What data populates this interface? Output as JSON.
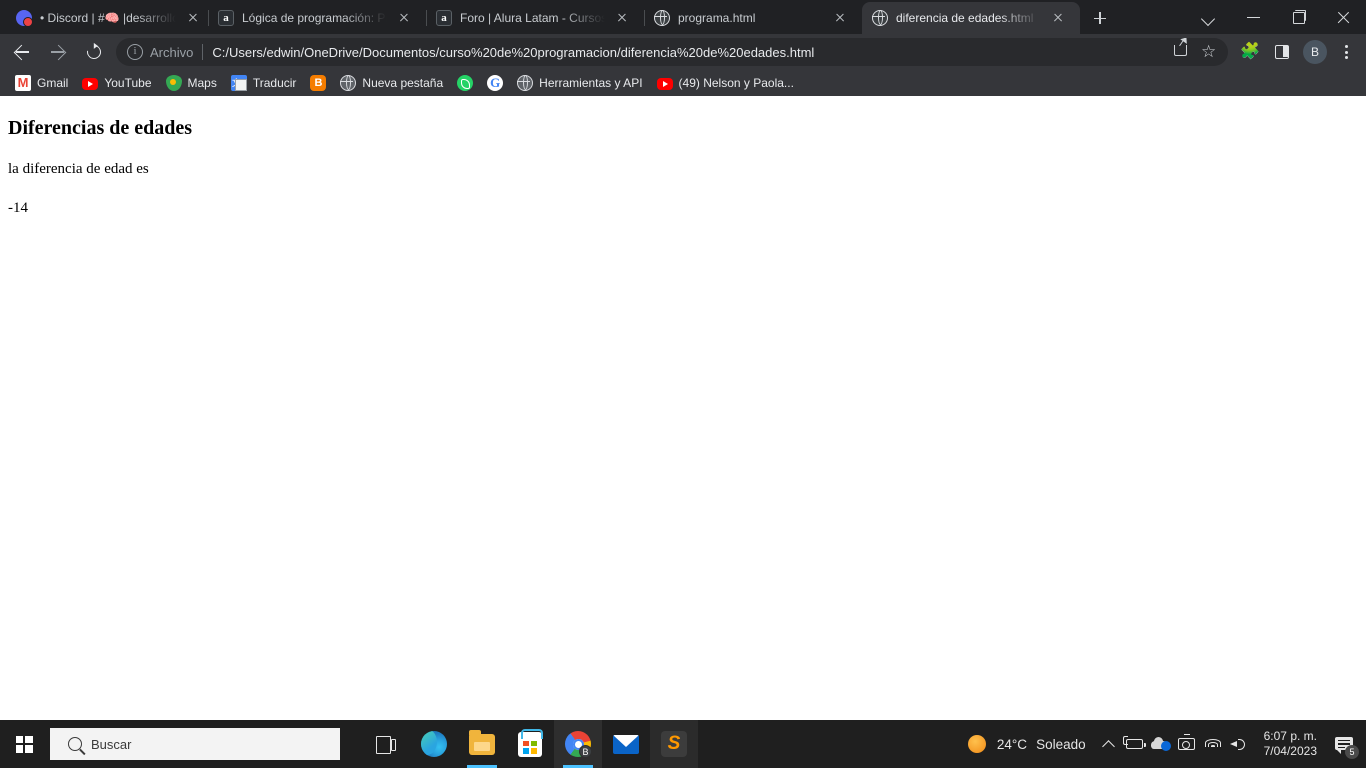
{
  "browser": {
    "tabs": [
      {
        "title": "• Discord | #🧠 |desarrollo-p",
        "favicon": "discord-icon",
        "active": false
      },
      {
        "title": "Lógica de programación: Prin",
        "favicon": "alura-icon",
        "active": false
      },
      {
        "title": "Foro | Alura Latam - Cursos o",
        "favicon": "alura-icon",
        "active": false
      },
      {
        "title": "programa.html",
        "favicon": "globe-icon",
        "active": false
      },
      {
        "title": "diferencia de edades.html",
        "favicon": "globe-icon",
        "active": true
      }
    ],
    "new_tab_label": "+",
    "window_controls": {
      "chevron": "chevron-down-icon",
      "minimize": "minimize-icon",
      "maximize": "maximize-icon",
      "close": "close-icon"
    },
    "toolbar": {
      "back": "back-arrow-icon",
      "forward": "forward-arrow-icon",
      "reload": "reload-icon",
      "scheme_label": "Archivo",
      "url": "C:/Users/edwin/OneDrive/Documentos/curso%20de%20programacion/diferencia%20de%20edades.html",
      "share": "share-icon",
      "bookmark_star": "☆",
      "extensions": "🧩",
      "side_panel": "side-panel-icon",
      "profile_initial": "B",
      "menu": "three-dot-menu-icon"
    },
    "bookmarks": [
      {
        "label": "Gmail",
        "icon": "gmail-icon",
        "glyph": "M"
      },
      {
        "label": "YouTube",
        "icon": "youtube-icon",
        "glyph": ""
      },
      {
        "label": "Maps",
        "icon": "maps-icon",
        "glyph": ""
      },
      {
        "label": "Traducir",
        "icon": "translate-icon",
        "glyph": "文"
      },
      {
        "label": "",
        "icon": "blogger-icon",
        "glyph": "B"
      },
      {
        "label": "Nueva pestaña",
        "icon": "globe-icon",
        "glyph": ""
      },
      {
        "label": "",
        "icon": "whatsapp-icon",
        "glyph": ""
      },
      {
        "label": "",
        "icon": "google-icon",
        "glyph": "G"
      },
      {
        "label": "Herramientas y API",
        "icon": "globe-icon",
        "glyph": ""
      },
      {
        "label": "(49) Nelson y Paola...",
        "icon": "youtube-icon",
        "glyph": ""
      }
    ]
  },
  "page": {
    "heading": "Diferencias de edades",
    "paragraph_1": "la diferencia de edad es",
    "paragraph_2": "-14"
  },
  "taskbar": {
    "start": "windows-logo-icon",
    "search_placeholder": "Buscar",
    "task_view": "task-view-icon",
    "apps": [
      {
        "name": "edge-icon",
        "running": false,
        "active": false
      },
      {
        "name": "file-explorer-icon",
        "running": true,
        "active": false
      },
      {
        "name": "microsoft-store-icon",
        "running": false,
        "active": false
      },
      {
        "name": "chrome-icon",
        "running": true,
        "active": true,
        "badge": "B"
      },
      {
        "name": "mail-icon",
        "running": false,
        "active": false
      },
      {
        "name": "sublime-text-icon",
        "running": false,
        "active": false
      }
    ],
    "weather": {
      "icon": "sun-icon",
      "temperature": "24°C",
      "condition": "Soleado"
    },
    "tray_icons": [
      "chevron-up-icon",
      "battery-charging-icon",
      "onedrive-sync-icon",
      "camera-icon",
      "wifi-icon",
      "volume-icon"
    ],
    "clock": {
      "time": "6:07 p. m.",
      "date": "7/04/2023"
    },
    "notifications": {
      "icon": "notification-icon",
      "count": "5"
    }
  },
  "colors": {
    "chrome_bg": "#202124",
    "toolbar_bg": "#35363a",
    "omnibox_bg": "#292a2d",
    "page_bg": "#ffffff",
    "taskbar_bg": "#1f1f1f",
    "accent": "#4cc2ff"
  }
}
